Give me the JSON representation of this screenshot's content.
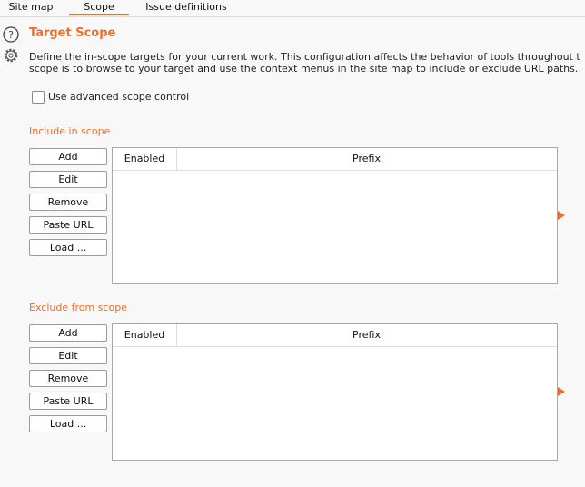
{
  "tabs": [
    {
      "label": "Site map",
      "active": false
    },
    {
      "label": "Scope",
      "active": true
    },
    {
      "label": "Issue definitions",
      "active": false
    }
  ],
  "header": {
    "title": "Target Scope",
    "description_line1": "Define the in-scope targets for your current work. This configuration affects the behavior of tools throughout t",
    "description_line2": "scope is to browse to your target and use the context menus in the site map to include or exclude URL paths."
  },
  "advanced_scope": {
    "label": "Use advanced scope control",
    "checked": false
  },
  "include": {
    "label": "Include in scope",
    "buttons": [
      "Add",
      "Edit",
      "Remove",
      "Paste URL",
      "Load ..."
    ],
    "columns": [
      "Enabled",
      "Prefix"
    ],
    "rows": []
  },
  "exclude": {
    "label": "Exclude from scope",
    "buttons": [
      "Add",
      "Edit",
      "Remove",
      "Paste URL",
      "Load ..."
    ],
    "columns": [
      "Enabled",
      "Prefix"
    ],
    "rows": []
  },
  "icons": {
    "help": "help-icon",
    "settings": "gear-icon",
    "expand": "expand-arrow-icon"
  },
  "colors": {
    "accent": "#e8702a",
    "background": "#f8f8f8",
    "table_background": "#ffffff",
    "border": "#a8a8a8"
  }
}
